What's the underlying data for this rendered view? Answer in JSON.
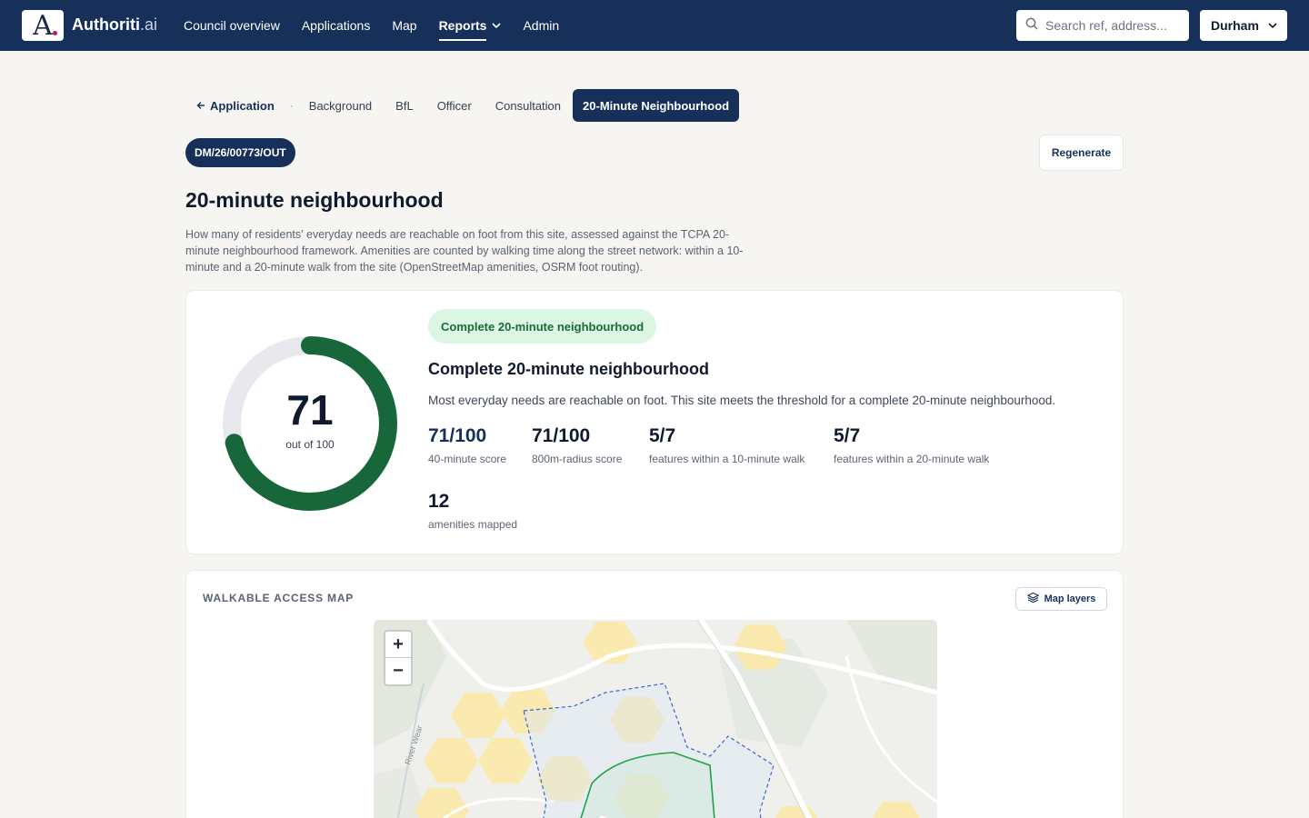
{
  "brand": {
    "logo_letter": "A",
    "name": "Authoriti",
    "suffix": ".ai"
  },
  "nav": {
    "items": [
      {
        "label": "Council overview"
      },
      {
        "label": "Applications"
      },
      {
        "label": "Map"
      },
      {
        "label": "Reports",
        "active": true
      },
      {
        "label": "Admin"
      }
    ],
    "search_placeholder": "Search ref, address...",
    "council": "Durham"
  },
  "tabs": {
    "back_label": "Application",
    "items": [
      "Background",
      "BfL",
      "Officer",
      "Consultation",
      "20-Minute Neighbourhood"
    ],
    "active": "20-Minute Neighbourhood"
  },
  "reference": "DM/26/00773/OUT",
  "regenerate_label": "Regenerate",
  "page": {
    "title": "20-minute neighbourhood",
    "description": "How many of residents' everyday needs are reachable on foot from this site, assessed against the TCPA 20-minute neighbourhood framework. Amenities are counted by walking time along the street network: within a 10-minute and a 20-minute walk from the site (OpenStreetMap amenities, OSRM foot routing)."
  },
  "score": {
    "value": "71",
    "max_label": "out of 100",
    "fraction": 0.71,
    "ring_color": "#17673a",
    "track_color": "#e8e9ee",
    "status_pill": "Complete 20-minute neighbourhood",
    "heading": "Complete 20-minute neighbourhood",
    "summary": "Most everyday needs are reachable on foot. This site meets the threshold for a complete 20-minute neighbourhood.",
    "stats": [
      {
        "value": "71/100",
        "label": "40-minute score"
      },
      {
        "value": "71/100",
        "label": "800m-radius score"
      },
      {
        "value": "5/7",
        "label": "features within a 10-minute walk"
      },
      {
        "value": "5/7",
        "label": "features within a 20-minute walk"
      },
      {
        "value": "12",
        "label": "amenities mapped"
      }
    ]
  },
  "map": {
    "heading": "WALKABLE ACCESS MAP",
    "layers_label": "Map layers",
    "river_label": "River Wear",
    "zoom_in": "+",
    "zoom_out": "−"
  }
}
